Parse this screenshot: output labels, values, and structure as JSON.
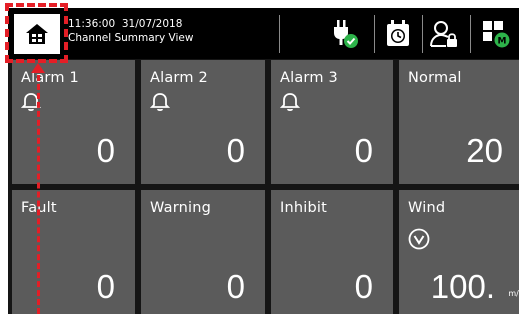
{
  "header": {
    "time": "11:36:00",
    "date": "31/07/2018",
    "view_title": "Channel Summary View",
    "icons": [
      "home-icon",
      "power-ok-icon",
      "calendar-clock-icon",
      "user-lock-icon",
      "module-ok-icon"
    ]
  },
  "tiles": [
    {
      "label": "Alarm 1",
      "value": "0",
      "icon": "bell-icon"
    },
    {
      "label": "Alarm 2",
      "value": "0",
      "icon": "bell-icon"
    },
    {
      "label": "Alarm 3",
      "value": "0",
      "icon": "bell-icon"
    },
    {
      "label": "Normal",
      "value": "20"
    },
    {
      "label": "Fault",
      "value": "0"
    },
    {
      "label": "Warning",
      "value": "0"
    },
    {
      "label": "Inhibit",
      "value": "0"
    },
    {
      "label": "Wind",
      "value": "100.",
      "unit": "m/s",
      "icon": "wind-direction-icon"
    }
  ],
  "colors": {
    "tile_bg": "#5b5b5b",
    "header_bg": "#000000",
    "highlight": "#e41e26",
    "status_ok": "#2db34a"
  }
}
